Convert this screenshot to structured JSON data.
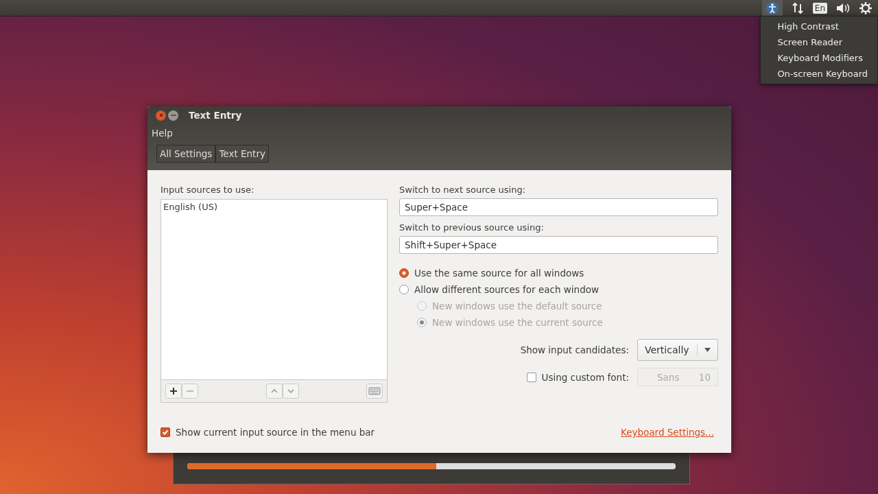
{
  "top_panel": {
    "keyboard_indicator": "En",
    "accessibility_menu": {
      "open": true,
      "items": [
        "High Contrast",
        "Screen Reader",
        "Keyboard Modifiers",
        "On-screen Keyboard"
      ]
    }
  },
  "background_dialog": {
    "progress": {
      "level": 0.51
    }
  },
  "window": {
    "title": "Text Entry",
    "menu": [
      "Help"
    ],
    "breadcrumbs": [
      "All Settings",
      "Text Entry"
    ],
    "input_sources": {
      "label": "Input sources to use:",
      "items": [
        {
          "name": "English (US)",
          "selected": false
        }
      ]
    },
    "next_source": {
      "label": "Switch to next source using:",
      "value": "Super+Space"
    },
    "previous_source": {
      "label": "Switch to previous source using:",
      "value": "Shift+Super+Space"
    },
    "source_mode": [
      {
        "label": "Use the same source for all windows",
        "selected": true,
        "disabled": false
      },
      {
        "label": "Allow different sources for each window",
        "selected": false,
        "disabled": false,
        "children": [
          {
            "label": "New windows use the default source",
            "selected": false,
            "disabled": true
          },
          {
            "label": "New windows use the current source",
            "selected": true,
            "disabled": true
          }
        ]
      }
    ],
    "candidates": {
      "label": "Show input candidates:",
      "value": "Vertically"
    },
    "custom_font": {
      "label": "Using custom font:",
      "checked": false,
      "font": "Sans",
      "size": "10",
      "disabled": true
    },
    "show_in_menu_bar": {
      "label": "Show current input source in the menu bar",
      "checked": true
    },
    "keyboard_settings_link": "Keyboard Settings..."
  }
}
